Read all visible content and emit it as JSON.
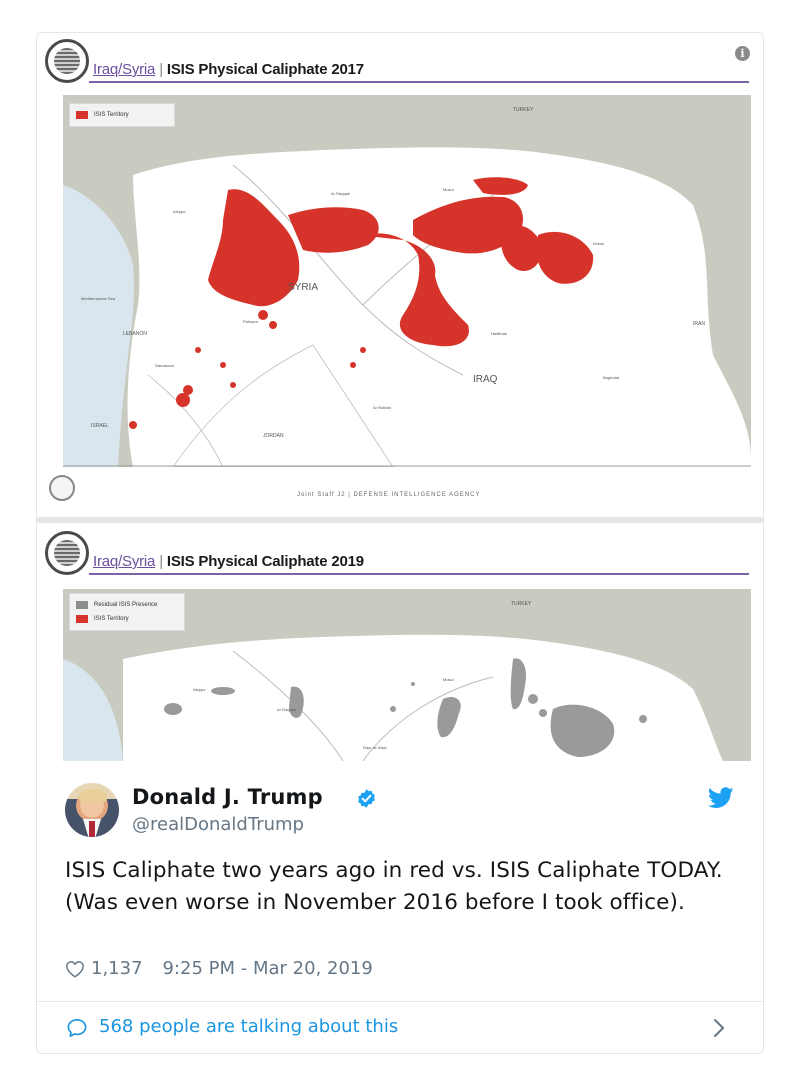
{
  "panels": [
    {
      "region": "Iraq/Syria",
      "separator": "|",
      "title": "ISIS Physical Caliphate 2017",
      "legend": [
        {
          "label": "ISIS Territory",
          "color": "#d6332a"
        }
      ],
      "labels": {
        "syria": "SYRIA",
        "iraq": "IRAQ",
        "turkey": "TURKEY",
        "iran": "IRAN",
        "lebanon": "LEBANON",
        "jordan": "JORDAN",
        "israel": "ISRAEL",
        "mediterranean": "Mediterranean Sea",
        "damascus": "Damascus",
        "aleppo": "Aleppo",
        "raqqa": "Ar Raqqah",
        "mosul": "Mosul",
        "baghdad": "Baghdad",
        "kirkuk": "Kirkuk",
        "hadithah": "Hadithah",
        "rutbah": "Ar Rutbah",
        "palmyra": "Palmyra"
      },
      "credit": "Joint Staff J2 | DEFENSE INTELLIGENCE AGENCY"
    },
    {
      "region": "Iraq/Syria",
      "separator": "|",
      "title": "ISIS Physical Caliphate 2019",
      "legend": [
        {
          "label": "Residual ISIS Presence",
          "color": "#8c8c8c"
        },
        {
          "label": "ISIS Territory",
          "color": "#d6332a"
        }
      ],
      "labels": {
        "turkey": "TURKEY",
        "aleppo": "Aleppo",
        "raqqa": "Ar Raqqah",
        "mosul": "Mosul",
        "deirezzor": "Dayr az Zawr"
      }
    }
  ],
  "tweet": {
    "name": "Donald J. Trump",
    "handle": "@realDonaldTrump",
    "text": "ISIS Caliphate two years ago in red vs. ISIS Caliphate TODAY. (Was even worse in November 2016 before I took office).",
    "likes": "1,137",
    "timestamp": "9:25 PM - Mar 20, 2019",
    "talking": "568 people are talking about this"
  },
  "colors": {
    "isis_red": "#d6332a",
    "residual_gray": "#8c8c8c",
    "twitter_blue": "#1da1f2",
    "link_blue": "#1b95e0",
    "title_rule": "#7c64a8"
  },
  "icons": {
    "seal": "dia-seal-icon",
    "info": "info-icon",
    "verified": "verified-badge-icon",
    "bird": "twitter-bird-icon",
    "heart": "heart-icon",
    "talk": "speech-bubble-icon",
    "chevron": "chevron-right-icon"
  }
}
